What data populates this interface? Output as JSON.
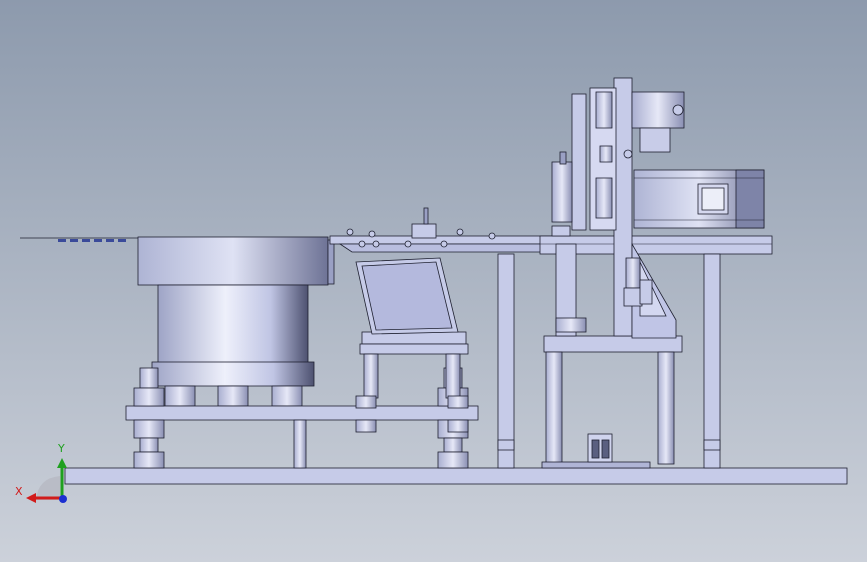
{
  "viewport": {
    "background_top": "#8d9aad",
    "background_bottom": "#c9ced8",
    "part_fill": "#c6cbe8",
    "part_shade": "#9aa0c4",
    "edge_color": "#1e2030"
  },
  "triad": {
    "x_label": "X",
    "y_label": "Y",
    "x_color": "#d11b1b",
    "y_color": "#1fa01f",
    "z_color": "#1b2fd1"
  }
}
